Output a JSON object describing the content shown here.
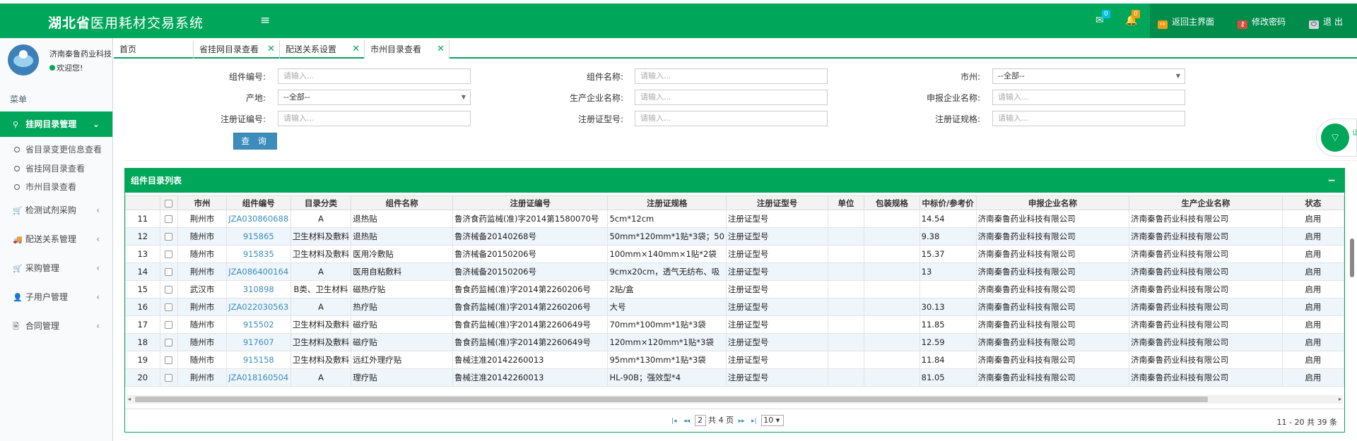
{
  "app": {
    "title_bold": "湖北省",
    "title_rest": "医用耗材交易系统",
    "menu_toggle": "≡"
  },
  "header": {
    "mail_count": "0",
    "bell_count": "0",
    "links": [
      {
        "label": "返回主界面",
        "icon": "home-icon"
      },
      {
        "label": "修改密码",
        "icon": "key-icon"
      },
      {
        "label": "退 出",
        "icon": "power-icon"
      }
    ]
  },
  "user": {
    "name": "济南秦鲁药业科技",
    "status": "欢迎您!"
  },
  "sidebar": {
    "menu_header": "菜单",
    "items": [
      {
        "label": "挂网目录管理",
        "icon": "map-marker-icon",
        "active": true
      },
      {
        "label": "检测试剂采购",
        "icon": "cart-icon"
      },
      {
        "label": "配送关系管理",
        "icon": "truck-icon"
      },
      {
        "label": "采购管理",
        "icon": "cart-icon"
      },
      {
        "label": "子用户管理",
        "icon": "user-icon"
      },
      {
        "label": "合同管理",
        "icon": "file-icon"
      }
    ],
    "subitems": [
      "省目录变更信息查看",
      "省挂网目录查看",
      "市州目录查看"
    ]
  },
  "tabs": [
    {
      "label": "首页"
    },
    {
      "label": "省挂网目录查看"
    },
    {
      "label": "配送关系设置"
    },
    {
      "label": "市州目录查看"
    }
  ],
  "form": {
    "fields": [
      {
        "label": "组件编号:",
        "placeholder": "请输入..."
      },
      {
        "label": "组件名称:",
        "placeholder": "请输入..."
      },
      {
        "label": "市州:",
        "value": "--全部--"
      },
      {
        "label": "产地:",
        "value": "--全部--"
      },
      {
        "label": "生产企业名称:",
        "placeholder": "请输入..."
      },
      {
        "label": "申报企业名称:",
        "placeholder": "请输入..."
      },
      {
        "label": "注册证编号:",
        "placeholder": "请输入..."
      },
      {
        "label": "注册证型号:",
        "placeholder": "请输入..."
      },
      {
        "label": "注册证规格:",
        "placeholder": "请输入..."
      }
    ],
    "query_button": "查 询"
  },
  "widget": {
    "text": "让"
  },
  "panel": {
    "title": "组件目录列表",
    "collapse": "−"
  },
  "table": {
    "columns": [
      "",
      "",
      "市州",
      "组件编号",
      "目录分类",
      "组件名称",
      "注册证编号",
      "注册证规格",
      "注册证型号",
      "单位",
      "包装规格",
      "中标价/参考价",
      "申报企业名称",
      "生产企业名称",
      "状态"
    ],
    "rows": [
      [
        "11",
        "荆州市",
        "JZA030860688",
        "A",
        "退热贴",
        "鲁济食药监械(准)字2014第1580070号",
        "5cm*12cm",
        "注册证型号",
        "",
        "",
        "14.54",
        "济南秦鲁药业科技有限公司",
        "济南秦鲁药业科技有限公司",
        "启用"
      ],
      [
        "12",
        "随州市",
        "915865",
        "卫生材料及敷料",
        "退热贴",
        "鲁济械备20140268号",
        "50mm*120mm*1贴*3袋；50",
        "注册证型号",
        "",
        "",
        "9.38",
        "济南秦鲁药业科技有限公司",
        "济南秦鲁药业科技有限公司",
        "启用"
      ],
      [
        "13",
        "随州市",
        "915835",
        "卫生材料及敷料",
        "医用冷敷贴",
        "鲁济械备20150206号",
        "100mm×140mm×1贴*2袋",
        "注册证型号",
        "",
        "",
        "15.37",
        "济南秦鲁药业科技有限公司",
        "济南秦鲁药业科技有限公司",
        "启用"
      ],
      [
        "14",
        "荆州市",
        "JZA086400164",
        "A",
        "医用自粘敷料",
        "鲁济械备20150206号",
        "9cmx20cm，透气无纺布、吸",
        "注册证型号",
        "",
        "",
        "13",
        "济南秦鲁药业科技有限公司",
        "济南秦鲁药业科技有限公司",
        "启用"
      ],
      [
        "15",
        "武汉市",
        "310898",
        "B类、卫生材料",
        "磁热疗贴",
        "鲁食药监械(准)字2014第2260206号",
        "2贴/盒",
        "注册证型号",
        "",
        "",
        "",
        "济南秦鲁药业科技有限公司",
        "济南秦鲁药业科技有限公司",
        "启用"
      ],
      [
        "16",
        "荆州市",
        "JZA022030563",
        "A",
        "热疗贴",
        "鲁食药监械(准)字2014第2260206号",
        "大号",
        "注册证型号",
        "",
        "",
        "30.13",
        "济南秦鲁药业科技有限公司",
        "济南秦鲁药业科技有限公司",
        "启用"
      ],
      [
        "17",
        "随州市",
        "915502",
        "卫生材料及敷料",
        "磁疗贴",
        "鲁食药监械(准)字2014第2260649号",
        "70mm*100mm*1贴*3袋",
        "注册证型号",
        "",
        "",
        "11.85",
        "济南秦鲁药业科技有限公司",
        "济南秦鲁药业科技有限公司",
        "启用"
      ],
      [
        "18",
        "随州市",
        "917607",
        "卫生材料及敷料",
        "磁疗贴",
        "鲁食药监械(准)字2014第2260649号",
        "120mm×120mm*1贴*3袋",
        "注册证型号",
        "",
        "",
        "12.59",
        "济南秦鲁药业科技有限公司",
        "济南秦鲁药业科技有限公司",
        "启用"
      ],
      [
        "19",
        "随州市",
        "915158",
        "卫生材料及敷料",
        "远红外理疗贴",
        "鲁械注准20142260013",
        "95mm*130mm*1贴*3袋",
        "注册证型号",
        "",
        "",
        "11.84",
        "济南秦鲁药业科技有限公司",
        "济南秦鲁药业科技有限公司",
        "启用"
      ],
      [
        "20",
        "荆州市",
        "JZA018160504",
        "A",
        "理疗贴",
        "鲁械注准20142260013",
        "HL-90B；强效型*4",
        "注册证型号",
        "",
        "",
        "81.05",
        "济南秦鲁药业科技有限公司",
        "济南秦鲁药业科技有限公司",
        "启用"
      ]
    ]
  },
  "pager": {
    "first": "|◂",
    "prev": "◂◂",
    "current_page": "2",
    "total_pages": "共 4 页",
    "next": "▸▸",
    "last": "▸|",
    "page_size": "10 ▾",
    "info": "11 - 20 共 39 条"
  },
  "colors": {
    "primary": "#00a65a",
    "primary_dark": "#008d4c",
    "link": "#3c8dbc",
    "button": "#3c8dbc"
  }
}
